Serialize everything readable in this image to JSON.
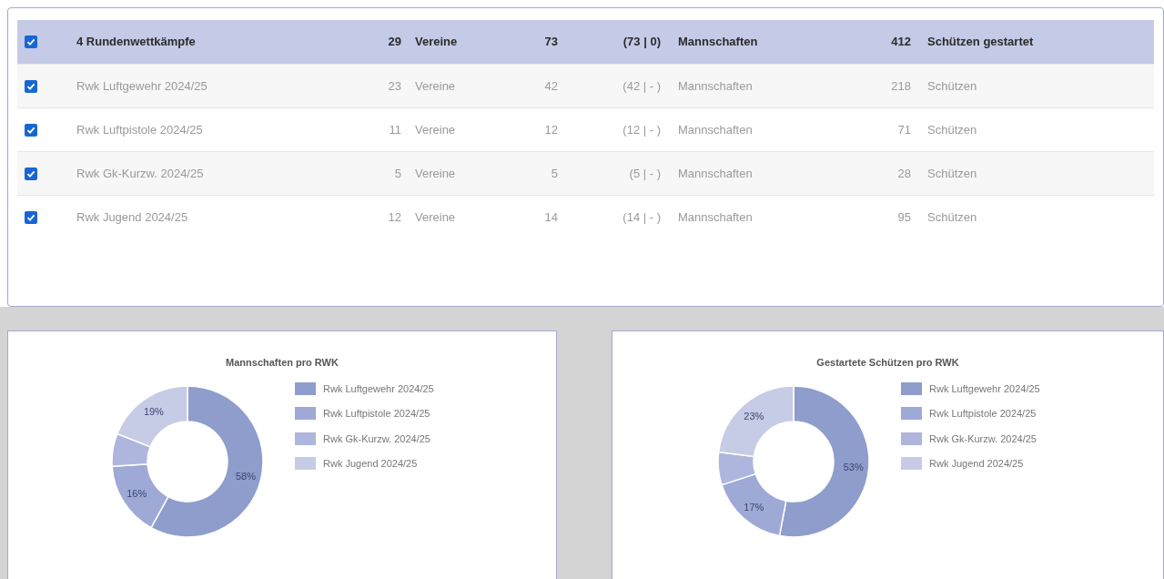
{
  "table": {
    "rows": [
      {
        "kind": "summary",
        "checked": true,
        "name": "4 Rundenwettkämpfe",
        "clubs": "29",
        "clubs_label": "Vereine",
        "teams": "73",
        "teams_split": "(73 | 0)",
        "teams_label": "Mannschaften",
        "shooters": "412",
        "shooters_label": "Schützen gestartet"
      },
      {
        "kind": "item",
        "checked": true,
        "name": "Rwk Luftgewehr 2024/25",
        "clubs": "23",
        "clubs_label": "Vereine",
        "teams": "42",
        "teams_split": "(42 | - )",
        "teams_label": "Mannschaften",
        "shooters": "218",
        "shooters_label": "Schützen"
      },
      {
        "kind": "item",
        "checked": true,
        "name": "Rwk Luftpistole 2024/25",
        "clubs": "11",
        "clubs_label": "Vereine",
        "teams": "12",
        "teams_split": "(12 | - )",
        "teams_label": "Mannschaften",
        "shooters": "71",
        "shooters_label": "Schützen"
      },
      {
        "kind": "item",
        "checked": true,
        "name": "Rwk Gk-Kurzw. 2024/25",
        "clubs": "5",
        "clubs_label": "Vereine",
        "teams": "5",
        "teams_split": "(5 | - )",
        "teams_label": "Mannschaften",
        "shooters": "28",
        "shooters_label": "Schützen"
      },
      {
        "kind": "item",
        "checked": true,
        "name": "Rwk Jugend 2024/25",
        "clubs": "12",
        "clubs_label": "Vereine",
        "teams": "14",
        "teams_split": "(14 | - )",
        "teams_label": "Mannschaften",
        "shooters": "95",
        "shooters_label": "Schützen"
      }
    ]
  },
  "charts": [
    {
      "chart_data": {
        "type": "donut",
        "title": "Mannschaften pro RWK",
        "categories": [
          "Rwk Luftgewehr 2024/25",
          "Rwk Luftpistole 2024/25",
          "Rwk Gk-Kurzw. 2024/25",
          "Rwk Jugend 2024/25"
        ],
        "values": [
          58,
          16,
          7,
          19
        ],
        "legend": "right",
        "colors": [
          "#8f9dcc",
          "#9ea9d6",
          "#aeb6de",
          "#c6cbe6"
        ],
        "value_labels": [
          "58%",
          "16%",
          null,
          "19%"
        ]
      }
    },
    {
      "chart_data": {
        "type": "donut",
        "title": "Gestartete Schützen pro RWK",
        "categories": [
          "Rwk Luftgewehr 2024/25",
          "Rwk Luftpistole 2024/25",
          "Rwk Gk-Kurzw. 2024/25",
          "Rwk Jugend 2024/25"
        ],
        "values": [
          53,
          17,
          7,
          23
        ],
        "legend": "right",
        "colors": [
          "#8f9dcc",
          "#9ea9d6",
          "#aeb6de",
          "#c6cbe6"
        ],
        "value_labels": [
          "53%",
          "17%",
          null,
          "23%"
        ]
      }
    }
  ]
}
